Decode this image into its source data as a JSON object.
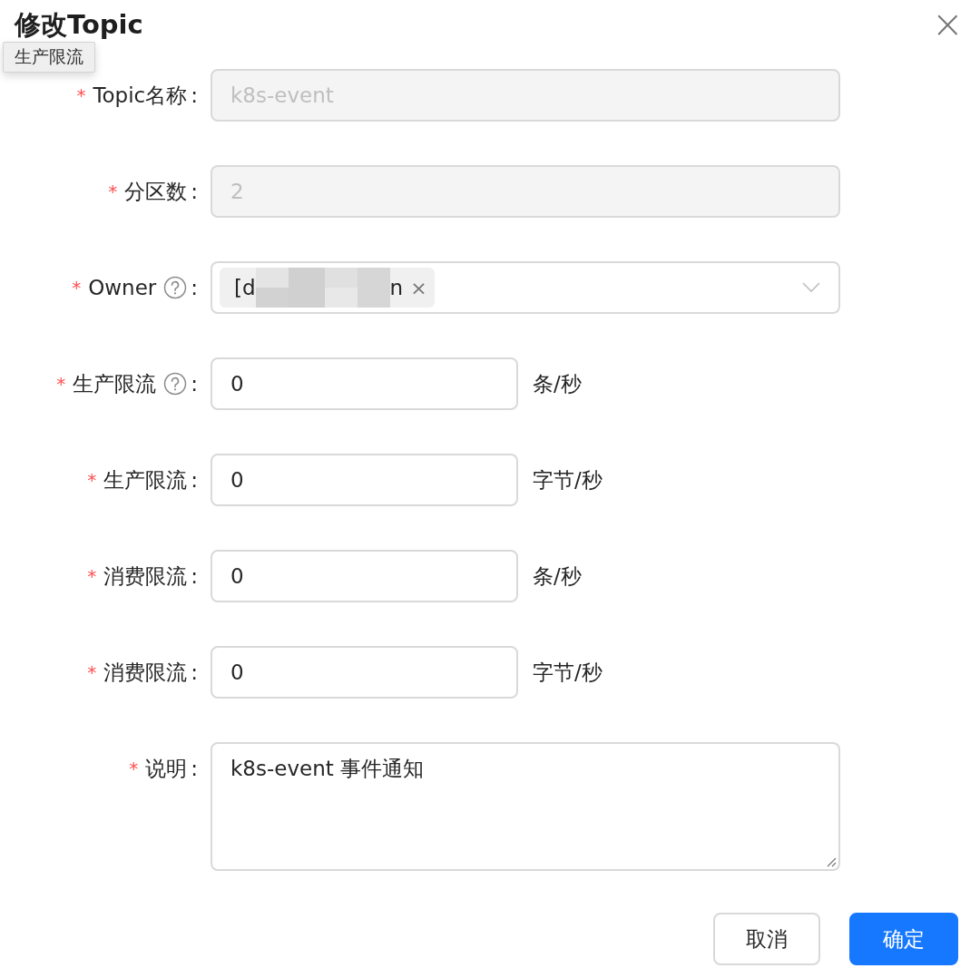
{
  "dialog": {
    "title": "修改Topic",
    "close": "×"
  },
  "tooltip": {
    "text": "生产限流"
  },
  "fields": [
    {
      "kind": "input",
      "required_mark": "*",
      "label": "Topic名称",
      "colon": ":",
      "value": "k8s-event",
      "disabled": true,
      "wide": true
    },
    {
      "kind": "input",
      "required_mark": "*",
      "label": "分区数",
      "colon": ":",
      "value": "2",
      "disabled": true,
      "wide": true
    },
    {
      "kind": "select",
      "required_mark": "*",
      "label": "Owner",
      "help": true,
      "colon": ":",
      "tag_start": "[d",
      "tag_end": "n",
      "tag_remove": "×"
    },
    {
      "kind": "input",
      "required_mark": "*",
      "label": "生产限流",
      "help": true,
      "colon": ":",
      "value": "0",
      "disabled": false,
      "wide": false,
      "suffix": "条/秒"
    },
    {
      "kind": "input",
      "required_mark": "*",
      "label": "生产限流",
      "colon": ":",
      "value": "0",
      "disabled": false,
      "wide": false,
      "suffix": "字节/秒"
    },
    {
      "kind": "input",
      "required_mark": "*",
      "label": "消费限流",
      "colon": ":",
      "value": "0",
      "disabled": false,
      "wide": false,
      "suffix": "条/秒"
    },
    {
      "kind": "input",
      "required_mark": "*",
      "label": "消费限流",
      "colon": ":",
      "value": "0",
      "disabled": false,
      "wide": false,
      "suffix": "字节/秒"
    },
    {
      "kind": "textarea",
      "required_mark": "*",
      "label": "说明",
      "colon": ":",
      "value": "k8s-event 事件通知"
    }
  ],
  "buttons": [
    {
      "label": "取消",
      "kind": "default"
    },
    {
      "label": "确定",
      "kind": "primary"
    }
  ]
}
